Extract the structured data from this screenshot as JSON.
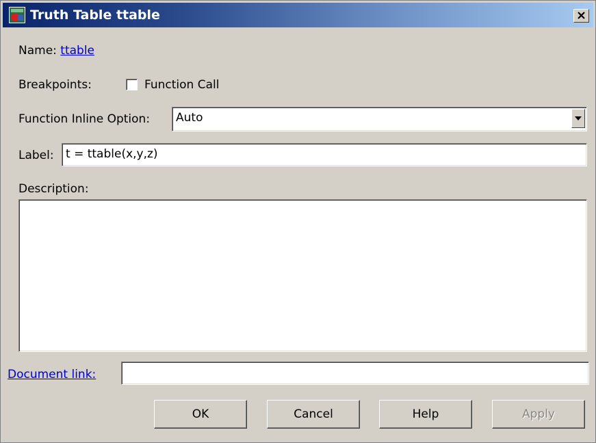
{
  "window": {
    "title": "Truth Table ttable",
    "close_glyph": "×"
  },
  "name_row": {
    "label": "Name:",
    "link": "ttable"
  },
  "breakpoints": {
    "label": "Breakpoints:",
    "checkbox_label": "Function Call",
    "checked": false
  },
  "inline_option": {
    "label": "Function Inline Option:",
    "selected": "Auto"
  },
  "label_field": {
    "label": "Label:",
    "value": "t = ttable(x,y,z)"
  },
  "description": {
    "label": "Description:",
    "value": ""
  },
  "document_link": {
    "label": "Document link:",
    "value": ""
  },
  "buttons": {
    "ok": "OK",
    "cancel": "Cancel",
    "help": "Help",
    "apply": "Apply"
  },
  "colors": {
    "titlebar_start": "#0a246a",
    "titlebar_end": "#a6caf0",
    "dialog_bg": "#d4d0c8",
    "link": "#0000cc"
  },
  "icons": [
    "stateflow-truth-table-icon",
    "close-icon",
    "chevron-down-icon"
  ]
}
